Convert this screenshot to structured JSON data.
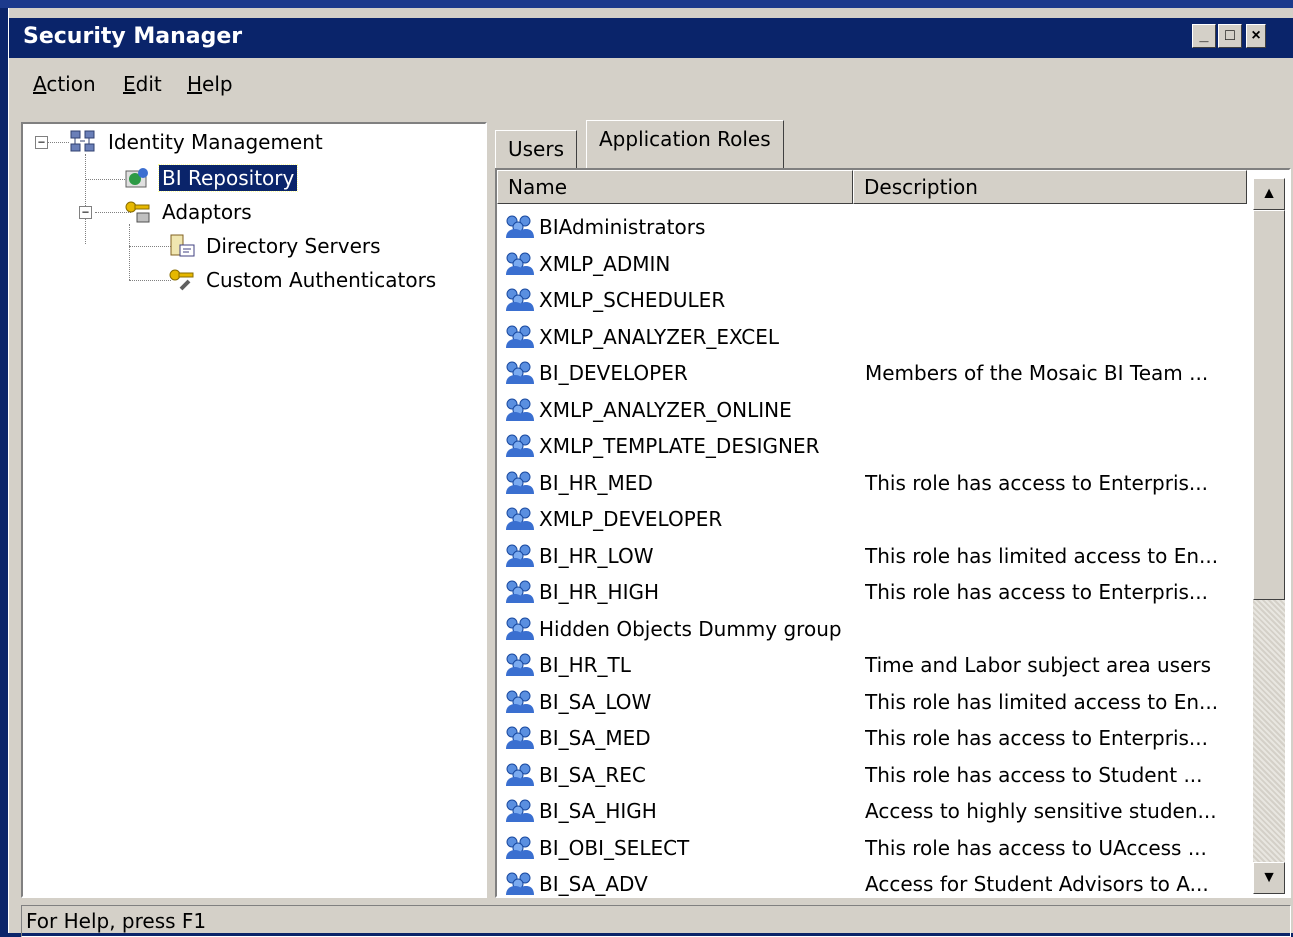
{
  "window": {
    "title": "Security Manager"
  },
  "menu": {
    "items": [
      "Action",
      "Edit",
      "Help"
    ]
  },
  "tree": {
    "nodes": [
      {
        "label": "Identity Management",
        "icon": "network-computers-icon",
        "expander": "−"
      },
      {
        "label": "BI Repository",
        "icon": "repository-icon",
        "selected": true
      },
      {
        "label": "Adaptors",
        "icon": "keys-computer-icon",
        "expander": "−"
      },
      {
        "label": "Directory Servers",
        "icon": "directory-server-icon"
      },
      {
        "label": "Custom Authenticators",
        "icon": "key-wrench-icon"
      }
    ]
  },
  "tabs": {
    "items": [
      "Users",
      "Application Roles"
    ],
    "active": 1
  },
  "list": {
    "columns": [
      "Name",
      "Description"
    ],
    "rows": [
      {
        "name": "BIAdministrators",
        "description": ""
      },
      {
        "name": "XMLP_ADMIN",
        "description": ""
      },
      {
        "name": "XMLP_SCHEDULER",
        "description": ""
      },
      {
        "name": "XMLP_ANALYZER_EXCEL",
        "description": ""
      },
      {
        "name": "BI_DEVELOPER",
        "description": "Members of the Mosaic BI Team ..."
      },
      {
        "name": "XMLP_ANALYZER_ONLINE",
        "description": ""
      },
      {
        "name": "XMLP_TEMPLATE_DESIGNER",
        "description": ""
      },
      {
        "name": "BI_HR_MED",
        "description": "This role has access to Enterpris..."
      },
      {
        "name": "XMLP_DEVELOPER",
        "description": ""
      },
      {
        "name": "BI_HR_LOW",
        "description": "This role has limited access to En..."
      },
      {
        "name": "BI_HR_HIGH",
        "description": "This role has access to Enterpris..."
      },
      {
        "name": "Hidden Objects Dummy group",
        "description": ""
      },
      {
        "name": "BI_HR_TL",
        "description": "Time and Labor subject area users"
      },
      {
        "name": "BI_SA_LOW",
        "description": "This role has limited access to En..."
      },
      {
        "name": "BI_SA_MED",
        "description": "This role has access to Enterpris..."
      },
      {
        "name": "BI_SA_REC",
        "description": "This role has access to Student ..."
      },
      {
        "name": "BI_SA_HIGH",
        "description": "Access to highly sensitive studen..."
      },
      {
        "name": "BI_OBI_SELECT",
        "description": "This role has access to UAccess ..."
      },
      {
        "name": "BI_SA_ADV",
        "description": "Access for Student Advisors to A..."
      }
    ]
  },
  "status": {
    "text": "For Help, press F1"
  },
  "colors": {
    "titlebar": "#0a246a",
    "face": "#d4d0c8",
    "selection": "#0a246a"
  }
}
